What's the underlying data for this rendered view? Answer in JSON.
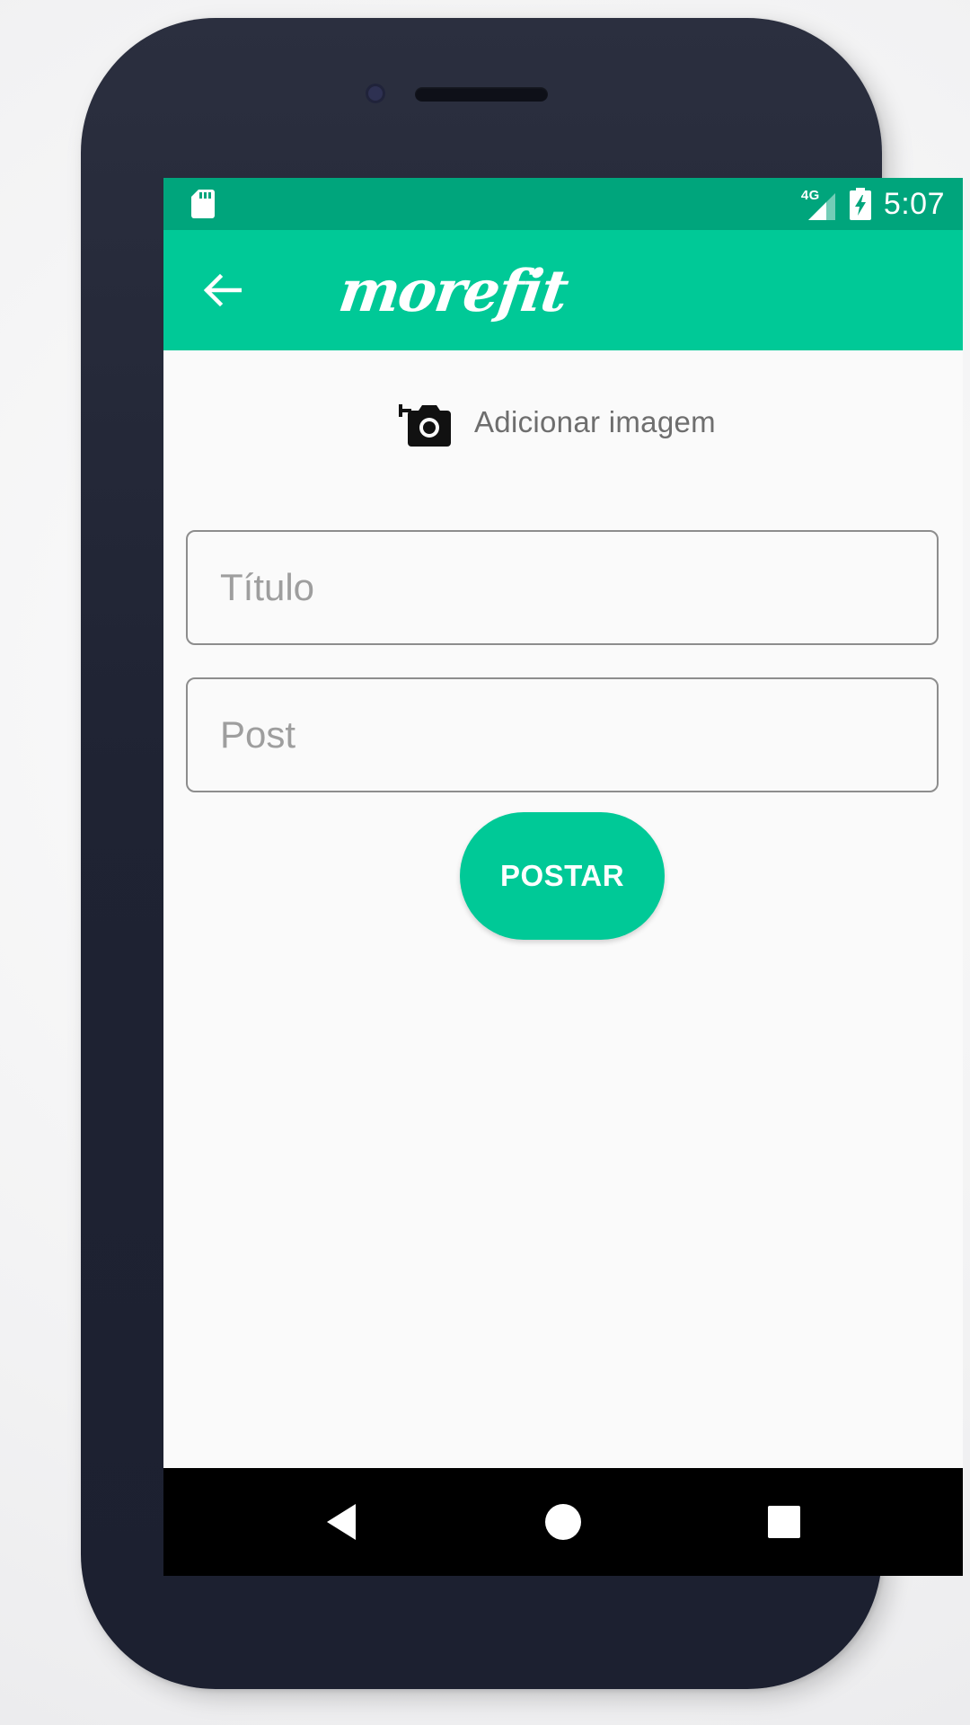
{
  "status_bar": {
    "time": "5:07",
    "network": "4G",
    "icons": [
      "sd-card-icon",
      "signal-icon",
      "battery-charging-icon"
    ]
  },
  "app_bar": {
    "logo_text": "morefit",
    "back_icon": "arrow-back-icon",
    "color": "#00c997"
  },
  "add_image": {
    "icon": "add-a-photo-icon",
    "label": "Adicionar imagem"
  },
  "form": {
    "title_placeholder": "Título",
    "title_value": "",
    "post_placeholder": "Post",
    "post_value": ""
  },
  "actions": {
    "post_label": "POSTAR"
  },
  "nav_bar": {
    "buttons": [
      "nav-back-icon",
      "nav-home-icon",
      "nav-recents-icon"
    ]
  },
  "colors": {
    "primary": "#00c997",
    "status_bar": "#00a57c",
    "background": "#fafafa"
  }
}
